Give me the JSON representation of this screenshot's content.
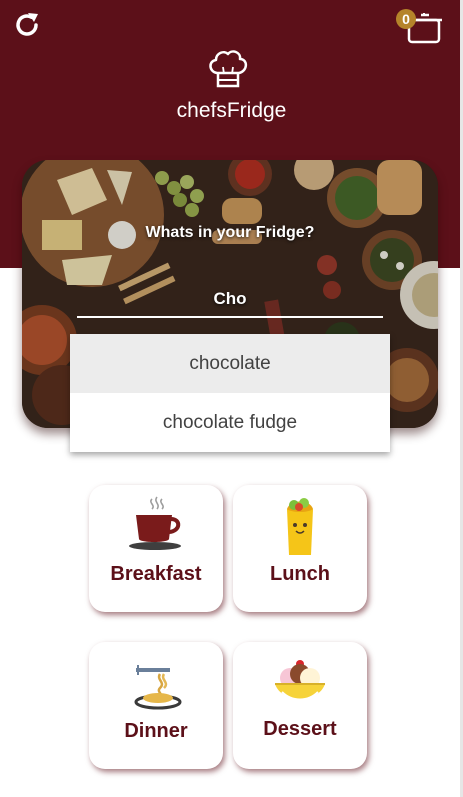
{
  "header": {
    "title": "chefsFridge",
    "cart_count": "0",
    "brand_color": "#5c1019",
    "badge_color": "#b5842a",
    "icons": [
      "refresh-icon",
      "cooking-pot-icon",
      "chef-hat-icon"
    ]
  },
  "hero": {
    "prompt": "Whats in your Fridge?",
    "search_value": "Cho"
  },
  "suggestions": [
    "chocolate",
    "chocolate fudge"
  ],
  "categories": [
    {
      "label": "Breakfast",
      "icon": "coffee-cup-icon"
    },
    {
      "label": "Lunch",
      "icon": "burrito-icon"
    },
    {
      "label": "Dinner",
      "icon": "spaghetti-icon"
    },
    {
      "label": "Dessert",
      "icon": "banana-split-icon"
    }
  ]
}
